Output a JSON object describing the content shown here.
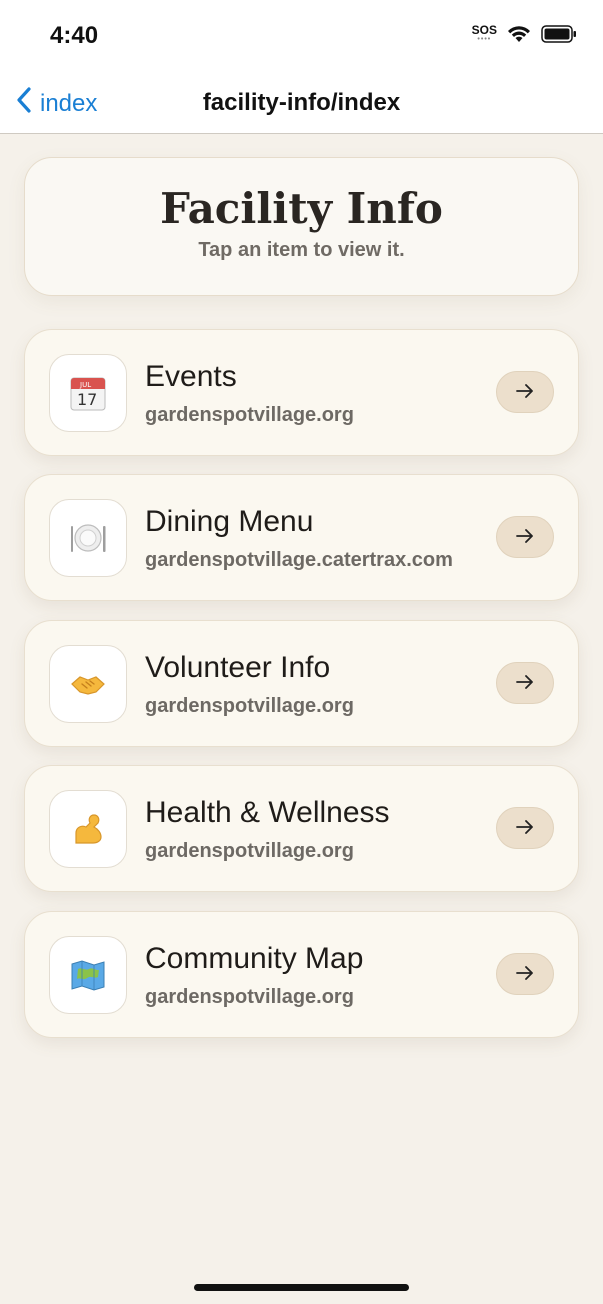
{
  "status": {
    "time": "4:40",
    "sos": "SOS"
  },
  "nav": {
    "back_label": "index",
    "title": "facility-info/index"
  },
  "header": {
    "title": "Facility Info",
    "subtitle": "Tap an item to view it."
  },
  "items": [
    {
      "title": "Events",
      "url": "gardenspotvillage.org",
      "icon": "calendar-icon"
    },
    {
      "title": "Dining Menu",
      "url": "gardenspotvillage.catertrax.com",
      "icon": "plate-cutlery-icon"
    },
    {
      "title": "Volunteer Info",
      "url": "gardenspotvillage.org",
      "icon": "handshake-icon"
    },
    {
      "title": "Health & Wellness",
      "url": "gardenspotvillage.org",
      "icon": "flexed-biceps-icon"
    },
    {
      "title": "Community Map",
      "url": "gardenspotvillage.org",
      "icon": "map-icon"
    }
  ],
  "colors": {
    "accent": "#1a7fd4",
    "background": "#f5f1ea",
    "card": "#fbf8f0",
    "arrow_pill": "#ecdfcc"
  }
}
